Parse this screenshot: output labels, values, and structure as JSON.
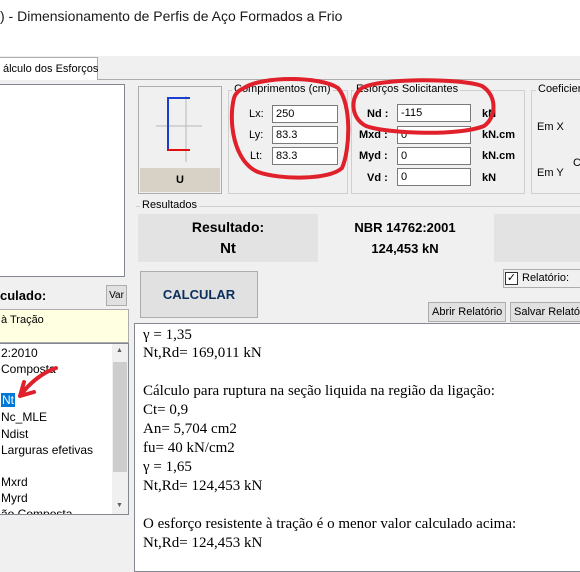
{
  "window": {
    "title": ") - Dimensionamento de Perfis de Aço Formados a Frio"
  },
  "tabs": [
    {
      "label": "álculo dos Esforços"
    }
  ],
  "left_panel": {
    "calculated_label": "culado:",
    "var_button": "Var",
    "selected_type": "à Tração",
    "list_items": [
      "2:2010",
      " Composta",
      "Nt",
      "Nc_MLE",
      "Ndist",
      "Larguras efetivas",
      "",
      "Mxrd",
      "Myrd",
      "ão Composta"
    ],
    "selected_index": 2
  },
  "profile": {
    "label": "U"
  },
  "comprimentos": {
    "title": "Comprimentos (cm)",
    "fields": [
      {
        "label": "Lx:",
        "value": "250"
      },
      {
        "label": "Ly:",
        "value": "83.3"
      },
      {
        "label": "Lt:",
        "value": "83.3"
      }
    ]
  },
  "esforcos": {
    "title": "Esforços Solicitantes",
    "fields": [
      {
        "label": "Nd :",
        "value": "-115",
        "unit": "kN"
      },
      {
        "label": "Mxd :",
        "value": "0",
        "unit": "kN.cm"
      },
      {
        "label": "Myd :",
        "value": "0",
        "unit": "kN.cm"
      },
      {
        "label": "Vd :",
        "value": "0",
        "unit": "kN"
      }
    ]
  },
  "coeficientes": {
    "title": "Coeficier",
    "em_x": "Em X",
    "em_y": "Em Y",
    "partial_c": "C"
  },
  "resultados": {
    "title": "Resultados",
    "label": "Resultado:",
    "value": "Nt",
    "norm": "NBR 14762:2001",
    "norm_value": "124,453 kN"
  },
  "actions": {
    "calcular": "CALCULAR",
    "relatorio_label": "Relatório:",
    "relatorio_checked": true,
    "abrir": "Abrir Relatório",
    "salvar": "Salvar Relatório"
  },
  "report_lines": [
    "γ = 1,35",
    "Nt,Rd= 169,011 kN",
    "",
    "Cálculo para ruptura na seção liquida na região da ligação:",
    "Ct= 0,9",
    "An= 5,704 cm2",
    "fu= 40 kN/cm2",
    "γ = 1,65",
    "Nt,Rd= 124,453 kN",
    "",
    "O esforço resistente à tração é o menor valor calculado acima:",
    "Nt,Rd= 124,453 kN"
  ],
  "colors": {
    "annotation": "#e0202a",
    "selection": "#0078d7",
    "tooltip_bg": "#ffffe1"
  }
}
